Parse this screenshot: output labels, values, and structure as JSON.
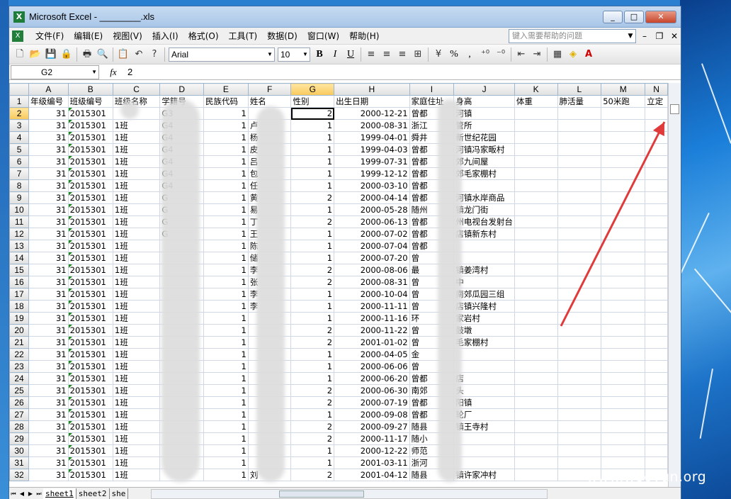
{
  "window": {
    "title": "Microsoft Excel - ________.xls",
    "minimize": "_",
    "maximize": "□",
    "close": "✕"
  },
  "menu": {
    "items": [
      "文件(F)",
      "编辑(E)",
      "视图(V)",
      "插入(I)",
      "格式(O)",
      "工具(T)",
      "数据(D)",
      "窗口(W)",
      "帮助(H)"
    ],
    "help_placeholder": "键入需要帮助的问题"
  },
  "toolbar": {
    "font": "Arial",
    "font_size": "10",
    "bold": "B",
    "italic": "I",
    "underline": "U",
    "percent": "%",
    "comma": ","
  },
  "formula_bar": {
    "name_box": "G2",
    "fx": "fx",
    "value": "2"
  },
  "grid": {
    "column_letters": [
      "A",
      "B",
      "C",
      "D",
      "E",
      "F",
      "G",
      "H",
      "I",
      "J",
      "K",
      "L",
      "M",
      "N"
    ],
    "selected_column": "G",
    "selected_row": "2",
    "header_row": [
      "年级编号",
      "班级编号",
      "班级名称",
      "学籍号",
      "民族代码",
      "姓名",
      "性别",
      "出生日期",
      "家庭住址",
      "身高",
      "体重",
      "肺活量",
      "50米跑",
      "立定"
    ],
    "rows": [
      {
        "n": "2",
        "a": "31",
        "b": "2015301",
        "c": "",
        "d": "G3",
        "e": "1",
        "f": "",
        "g": "2",
        "h": "2000-12-21",
        "i": "曾都",
        "j": "河镇"
      },
      {
        "n": "3",
        "a": "31",
        "b": "2015301",
        "c": "1班",
        "d": "G4",
        "e": "1",
        "f": "卢",
        "g": "1",
        "h": "2000-08-31",
        "i": "浙江",
        "j": "管所"
      },
      {
        "n": "4",
        "a": "31",
        "b": "2015301",
        "c": "1班",
        "d": "G4",
        "e": "1",
        "f": "杨",
        "g": "1",
        "h": "1999-04-01",
        "i": "舜井",
        "j": "新世纪花园"
      },
      {
        "n": "5",
        "a": "31",
        "b": "2015301",
        "c": "1班",
        "d": "G4",
        "e": "1",
        "f": "皮",
        "g": "1",
        "h": "1999-04-03",
        "i": "曾都",
        "j": "河镇冯家畈村"
      },
      {
        "n": "6",
        "a": "31",
        "b": "2015301",
        "c": "1班",
        "d": "G4",
        "e": "1",
        "f": "吕",
        "g": "1",
        "h": "1999-07-31",
        "i": "曾都",
        "j": "郊九间屋"
      },
      {
        "n": "7",
        "a": "31",
        "b": "2015301",
        "c": "1班",
        "d": "G4",
        "e": "1",
        "f": "包",
        "g": "1",
        "h": "1999-12-12",
        "i": "曾都",
        "j": "郊毛家棚村"
      },
      {
        "n": "8",
        "a": "31",
        "b": "2015301",
        "c": "1班",
        "d": "G4",
        "e": "1",
        "f": "任",
        "g": "1",
        "h": "2000-03-10",
        "i": "曾都",
        "j": ""
      },
      {
        "n": "9",
        "a": "31",
        "b": "2015301",
        "c": "1班",
        "d": "G",
        "e": "1",
        "f": "黄",
        "g": "2",
        "h": "2000-04-14",
        "i": "曾都",
        "j": "河镇水岸商品"
      },
      {
        "n": "10",
        "a": "31",
        "b": "2015301",
        "c": "1班",
        "d": "G",
        "e": "1",
        "f": "易",
        "g": "1",
        "h": "2000-05-28",
        "i": "随州",
        "j": "镇龙门街"
      },
      {
        "n": "11",
        "a": "31",
        "b": "2015301",
        "c": "1班",
        "d": "G",
        "e": "1",
        "f": "丁",
        "g": "2",
        "h": "2000-06-13",
        "i": "曾都",
        "j": "州电视台发射台"
      },
      {
        "n": "12",
        "a": "31",
        "b": "2015301",
        "c": "1班",
        "d": "G",
        "e": "1",
        "f": "王",
        "g": "1",
        "h": "2000-07-02",
        "i": "曾都",
        "j": "店镇新东村"
      },
      {
        "n": "13",
        "a": "31",
        "b": "2015301",
        "c": "1班",
        "d": "",
        "e": "1",
        "f": "陈",
        "g": "1",
        "h": "2000-07-04",
        "i": "曾都",
        "j": ""
      },
      {
        "n": "14",
        "a": "31",
        "b": "2015301",
        "c": "1班",
        "d": "",
        "e": "1",
        "f": "储",
        "g": "1",
        "h": "2000-07-20",
        "i": "曾",
        "j": ""
      },
      {
        "n": "15",
        "a": "31",
        "b": "2015301",
        "c": "1班",
        "d": "",
        "e": "1",
        "f": "李",
        "g": "2",
        "h": "2000-08-06",
        "i": "最",
        "j": "镇姜湾村"
      },
      {
        "n": "16",
        "a": "31",
        "b": "2015301",
        "c": "1班",
        "d": "",
        "e": "1",
        "f": "张",
        "g": "2",
        "h": "2000-08-31",
        "i": "曾",
        "j": "中"
      },
      {
        "n": "17",
        "a": "31",
        "b": "2015301",
        "c": "1班",
        "d": "",
        "e": "1",
        "f": "李",
        "g": "1",
        "h": "2000-10-04",
        "i": "曾",
        "j": "南郊瓜园三组"
      },
      {
        "n": "18",
        "a": "31",
        "b": "2015301",
        "c": "1班",
        "d": "",
        "e": "1",
        "f": "李",
        "g": "1",
        "h": "2000-11-11",
        "i": "曾",
        "j": "店镇兴隆村"
      },
      {
        "n": "19",
        "a": "31",
        "b": "2015301",
        "c": "1班",
        "d": "",
        "e": "1",
        "f": "",
        "g": "1",
        "h": "2000-11-16",
        "i": "环",
        "j": "家岩村"
      },
      {
        "n": "20",
        "a": "31",
        "b": "2015301",
        "c": "1班",
        "d": "",
        "e": "1",
        "f": "",
        "g": "2",
        "h": "2000-11-22",
        "i": "曾",
        "j": "鼓墩"
      },
      {
        "n": "21",
        "a": "31",
        "b": "2015301",
        "c": "1班",
        "d": "",
        "e": "1",
        "f": "",
        "g": "2",
        "h": "2001-01-02",
        "i": "曾",
        "j": "毛家棚村"
      },
      {
        "n": "22",
        "a": "31",
        "b": "2015301",
        "c": "1班",
        "d": "",
        "e": "1",
        "f": "",
        "g": "1",
        "h": "2000-04-05",
        "i": "金",
        "j": ""
      },
      {
        "n": "23",
        "a": "31",
        "b": "2015301",
        "c": "1班",
        "d": "",
        "e": "1",
        "f": "",
        "g": "1",
        "h": "2000-06-06",
        "i": "曾",
        "j": ""
      },
      {
        "n": "24",
        "a": "31",
        "b": "2015301",
        "c": "1班",
        "d": "",
        "e": "1",
        "f": "",
        "g": "1",
        "h": "2000-06-20",
        "i": "曾都",
        "j": "店"
      },
      {
        "n": "25",
        "a": "31",
        "b": "2015301",
        "c": "1班",
        "d": "",
        "e": "1",
        "f": "",
        "g": "2",
        "h": "2000-06-30",
        "i": "南郊",
        "j": "头"
      },
      {
        "n": "26",
        "a": "31",
        "b": "2015301",
        "c": "1班",
        "d": "",
        "e": "1",
        "f": "",
        "g": "2",
        "h": "2000-07-19",
        "i": "曾都",
        "j": "阳镇"
      },
      {
        "n": "27",
        "a": "31",
        "b": "2015301",
        "c": "1班",
        "d": "",
        "e": "1",
        "f": "",
        "g": "1",
        "h": "2000-09-08",
        "i": "曾都",
        "j": "轮厂"
      },
      {
        "n": "28",
        "a": "31",
        "b": "2015301",
        "c": "1班",
        "d": "",
        "e": "1",
        "f": "",
        "g": "2",
        "h": "2000-09-27",
        "i": "随县",
        "j": "镇王寺村"
      },
      {
        "n": "29",
        "a": "31",
        "b": "2015301",
        "c": "1班",
        "d": "",
        "e": "1",
        "f": "",
        "g": "2",
        "h": "2000-11-17",
        "i": "随小",
        "j": ""
      },
      {
        "n": "30",
        "a": "31",
        "b": "2015301",
        "c": "1班",
        "d": "",
        "e": "1",
        "f": "",
        "g": "1",
        "h": "2000-12-22",
        "i": "师范",
        "j": ""
      },
      {
        "n": "31",
        "a": "31",
        "b": "2015301",
        "c": "1班",
        "d": "",
        "e": "1",
        "f": "",
        "g": "1",
        "h": "2001-03-11",
        "i": "浙河",
        "j": ""
      },
      {
        "n": "32",
        "a": "31",
        "b": "2015301",
        "c": "1班",
        "d": "",
        "e": "1",
        "f": "刘",
        "g": "2",
        "h": "2001-04-12",
        "i": "随县",
        "j": "镇许家冲村"
      }
    ]
  },
  "sheets": [
    "sheet1",
    "sheet2",
    "she"
  ],
  "watermark": "www.wooyun.org",
  "colors": {
    "arrow": "#e03a3a",
    "selection": "#f8c95c",
    "titlebar": "#a9c6e8"
  }
}
